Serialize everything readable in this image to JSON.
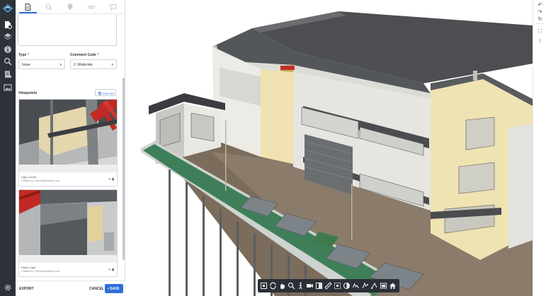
{
  "rail": {
    "icons": [
      "app-logo",
      "file-info-icon",
      "layers-icon",
      "info-icon",
      "search-icon",
      "clipboard-icon",
      "image-icon",
      "settings-icon"
    ]
  },
  "tabs": [
    "details-tab",
    "search-tab",
    "pin-tab",
    "link-tab",
    "comments-tab"
  ],
  "form": {
    "type_label": "Type",
    "type_value": "Issue",
    "code_label": "Comment Code",
    "code_value": "2: Moderate"
  },
  "viewpoints": {
    "label": "Viewpoints",
    "add_pin": "ADD PIN",
    "items": [
      {
        "title": "Ugly Corner",
        "author": "Created by: Farzan@example.com"
      },
      {
        "title": "Hatch Light",
        "author": "Created by: Farzan@example.com"
      }
    ]
  },
  "footer": {
    "export": "EXPORT",
    "cancel": "CANCEL",
    "save": "SAVE"
  },
  "colors": {
    "rail_bg": "#2e3238",
    "accent": "#2f6fd6",
    "toolbar_bg": "#2b2f36",
    "wall_light": "#e8e8e4",
    "wall_yellow": "#ece0b2",
    "roof": "#4b4d50",
    "ground": "#7e6f5e",
    "steel_red": "#c62d28"
  }
}
